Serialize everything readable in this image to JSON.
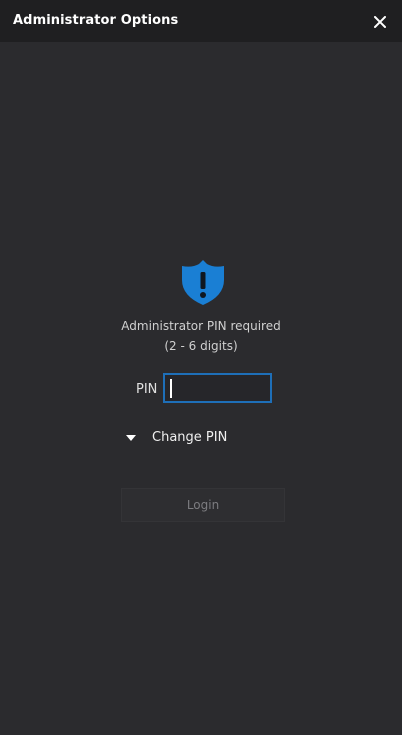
{
  "window": {
    "title": "Administrator Options"
  },
  "icons": {
    "close": "close-icon",
    "shield": "shield-alert-icon",
    "expander": "triangle-down-icon"
  },
  "colors": {
    "accent": "#1e6fb8",
    "shield": "#1a7fd4",
    "background": "#2b2b2e",
    "titlebar": "#1f1f21"
  },
  "message": {
    "line1": "Administrator PIN required",
    "line2": "(2 - 6 digits)"
  },
  "pin": {
    "label": "PIN",
    "value": ""
  },
  "change_pin": {
    "label": "Change PIN"
  },
  "login": {
    "label": "Login",
    "enabled": false
  }
}
